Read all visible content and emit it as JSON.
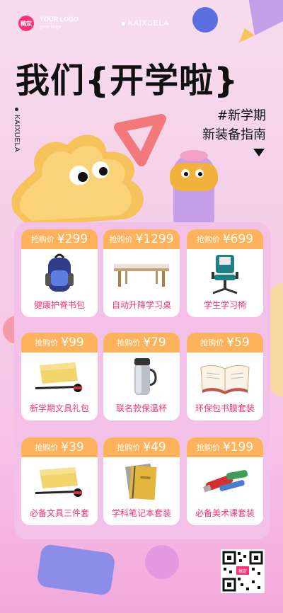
{
  "header": {
    "logo_badge": "稿定",
    "logo_title": "YOUR LOGO",
    "logo_sub": "yourlogo",
    "brand": "KAIXUELA"
  },
  "title": "我们{开学啦}",
  "side_brand": "KAIXUELA",
  "tagline": {
    "line1": "#新学期",
    "line2": "新装备指南"
  },
  "price_label": "抢购价",
  "products": [
    {
      "price": "¥299",
      "name": "健康护脊书包",
      "icon": "backpack-icon"
    },
    {
      "price": "¥1299",
      "name": "自动升降学习桌",
      "icon": "desk-icon"
    },
    {
      "price": "¥699",
      "name": "学生学习椅",
      "icon": "chair-icon"
    },
    {
      "price": "¥99",
      "name": "新学期文具礼包",
      "icon": "stationery-icon"
    },
    {
      "price": "¥79",
      "name": "联名款保温杯",
      "icon": "thermos-icon"
    },
    {
      "price": "¥59",
      "name": "环保包书膜套装",
      "icon": "book-icon"
    },
    {
      "price": "¥39",
      "name": "必备文具三件套",
      "icon": "stationery-icon"
    },
    {
      "price": "¥49",
      "name": "学科笔记本套装",
      "icon": "notebook-icon"
    },
    {
      "price": "¥199",
      "name": "必备美术课套装",
      "icon": "paint-icon"
    }
  ],
  "qr": {
    "center_label": "稿定"
  },
  "colors": {
    "accent": "#ff2f7a",
    "price_bg": "#ffb25c",
    "panel": "#f3c1e8"
  }
}
